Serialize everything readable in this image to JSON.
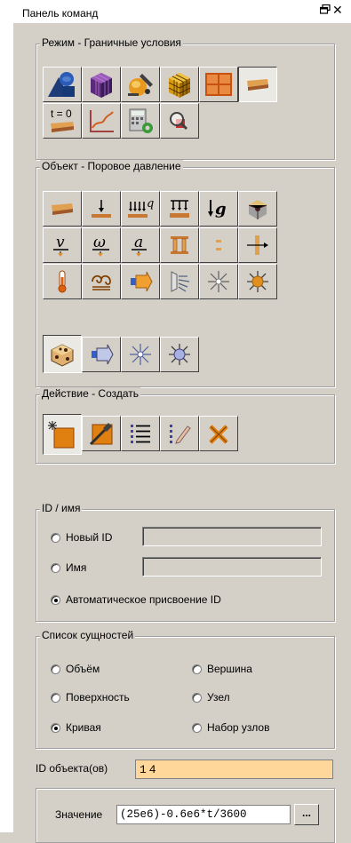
{
  "panel": {
    "title": "Панель команд",
    "pin_glyph": "🗗",
    "close_glyph": "✕"
  },
  "mode_group": {
    "legend": "Режим - Граничные условия",
    "buttons": [
      {
        "icon": "volume-shapes-icon"
      },
      {
        "icon": "mesh-cube-icon"
      },
      {
        "icon": "geometry-tools-icon"
      },
      {
        "icon": "hex-mesh-cube-icon"
      },
      {
        "icon": "grid-block-icon"
      },
      {
        "icon": "boundary-condition-icon"
      },
      {
        "icon": "initial-condition-icon",
        "label": "t = 0"
      },
      {
        "icon": "function-graph-icon"
      },
      {
        "icon": "calculator-settings-icon"
      },
      {
        "icon": "inspect-magnifier-icon"
      }
    ]
  },
  "object_group": {
    "legend": "Объект - Поровое давление",
    "buttons": [
      {
        "icon": "pore-pressure-icon"
      },
      {
        "icon": "point-load-icon"
      },
      {
        "icon": "distributed-load-icon",
        "sup": "q"
      },
      {
        "icon": "pressure-icon"
      },
      {
        "icon": "gravity-icon",
        "label": "g"
      },
      {
        "icon": "spider-constraint-icon"
      },
      {
        "icon": "velocity-icon",
        "label": "v"
      },
      {
        "icon": "angular-velocity-icon",
        "label": "ω"
      },
      {
        "icon": "acceleration-icon",
        "label": "a"
      },
      {
        "icon": "column-support-icon"
      },
      {
        "icon": "dashed-constraint-icon"
      },
      {
        "icon": "axial-displacement-icon"
      },
      {
        "icon": "thermometer-icon"
      },
      {
        "icon": "convection-coil-icon"
      },
      {
        "icon": "heat-flux-arrow-icon"
      },
      {
        "icon": "heat-surface-flux-icon"
      },
      {
        "icon": "radiation-star-icon"
      },
      {
        "icon": "heat-source-sun-icon"
      },
      {
        "icon": "volume-heat-cube-icon"
      },
      {
        "icon": "heat-flux-arrow-icon"
      },
      {
        "icon": "radiation-star-icon"
      },
      {
        "icon": "heat-source-blue-icon"
      }
    ]
  },
  "action_group": {
    "legend": "Действие - Создать",
    "buttons": [
      {
        "icon": "create-new-icon"
      },
      {
        "icon": "modify-hammer-icon"
      },
      {
        "icon": "list-icon"
      },
      {
        "icon": "edit-list-icon"
      },
      {
        "icon": "delete-tools-icon"
      }
    ]
  },
  "id_group": {
    "legend": "ID / имя",
    "new_id_label": "Новый ID",
    "name_label": "Имя",
    "auto_label": "Автоматическое присвоение ID",
    "new_id_value": "",
    "name_value": ""
  },
  "entity_group": {
    "legend": "Список сущностей",
    "options": [
      "Объём",
      "Вершина",
      "Поверхность",
      "Узел",
      "Кривая",
      "Набор узлов"
    ],
    "selected": "Кривая"
  },
  "entity_id": {
    "label": "ID объекта(ов)",
    "value": "14"
  },
  "value_row": {
    "label": "Значение",
    "value": "(25e6)-0.6e6*t/3600",
    "browse_label": "..."
  }
}
